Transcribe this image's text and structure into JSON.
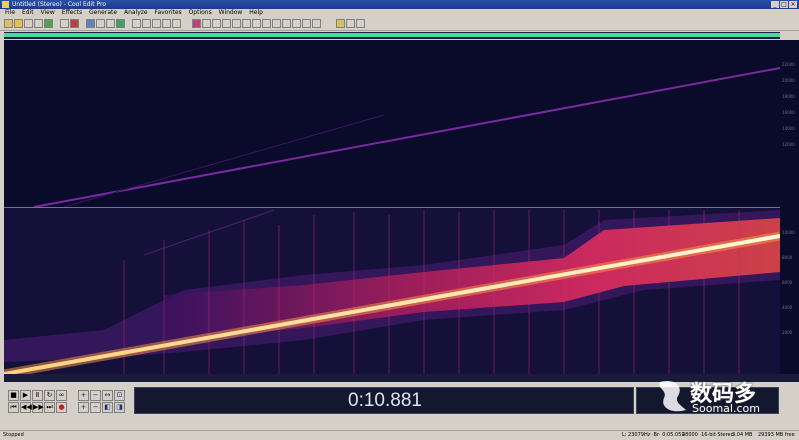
{
  "window": {
    "title": "Untitled (Stereo) - Cool Edit Pro"
  },
  "menu": [
    "File",
    "Edit",
    "View",
    "Effects",
    "Generate",
    "Analyze",
    "Favorites",
    "Options",
    "Window",
    "Help"
  ],
  "time_display": "0:10.881",
  "watermark": {
    "brand": "数码多",
    "site": "Soomal.com"
  },
  "status": {
    "left": "Stopped",
    "sample": "L: 23079Hz ·Br· 0:05.051",
    "format": "48000 ·16-bit·Stereo",
    "size": "3.04 MB",
    "free": "29393 MB free"
  },
  "yscale_ticks": [
    "22000",
    "20000",
    "18000",
    "16000",
    "14000",
    "12000",
    "10000",
    "8000",
    "6000",
    "4000",
    "2000"
  ],
  "colors": {
    "background": "#0a0a2a",
    "sweep": "#fff6c8",
    "energy": "#ff2a6a",
    "ruler": "#4fd8a0"
  },
  "toolbar_icons": [
    "open-icon",
    "save-icon",
    "cut-icon",
    "copy-icon",
    "paste-icon",
    "undo-icon",
    "mix-icon",
    "effects-icon",
    "zoom-icon",
    "spectral-icon",
    "loop-icon"
  ]
}
